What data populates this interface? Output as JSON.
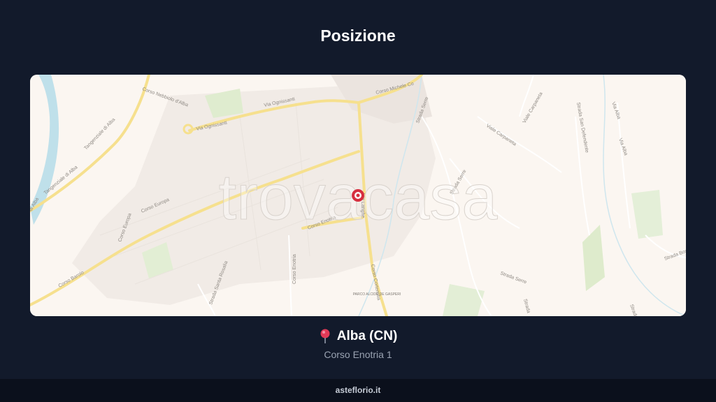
{
  "header": {
    "title": "Posizione"
  },
  "map": {
    "watermark": "trovacasa",
    "streets": {
      "corso_nebbiolo": "Corso Nebbiolo d'Alba",
      "via_ognissanti_1": "Via Ognissanti",
      "via_ognissanti_2": "Via Ognissanti",
      "corso_michele": "Corso Michele Co",
      "tangenziale_1": "Tangenziale di Alba",
      "tangenziale_2": "Tangenziale di Alba",
      "di_alba": "di Alba",
      "corso_europa_1": "Corso Europa",
      "corso_europa_2": "Corso Europa",
      "corso_enotria_1": "Corso Enotria",
      "corso_enotria_2": "Corso Enotria",
      "via_langhe": "Via Langhe",
      "corso_cortemilia": "Corso Cortemilia",
      "corso_barolo": "Corso Barolo",
      "strada_santa_rosalia": "Strada Santa Rosalia",
      "parco": "PARCO ALCIDE DE GASPERI",
      "strada_serre_1": "Strada Serre",
      "strada_serre_2": "Strada Serre",
      "strada_serre_3": "Strada Serre",
      "strada_serre_4": "Strada",
      "viale_carpaneta_1": "Viale Carpaneta",
      "viale_carpaneta_2": "Viale Carpaneta",
      "strada_san_defendente": "Strada San Defendente",
      "via_alba_1": "Via Alba",
      "via_alba_2": "Via Alba",
      "strada_bossola": "Strada Bossola",
      "strada_cu": "Strada Cu"
    }
  },
  "location": {
    "pin_icon": "round-pushpin-icon",
    "city": "Alba (CN)",
    "address": "Corso Enotria 1"
  },
  "footer": {
    "site": "asteflorio.it"
  },
  "colors": {
    "background": "#121a2b",
    "footer_bg": "#0b101c",
    "map_bg": "#fbf6f1",
    "main_road": "#f6e08e",
    "pin": "#d62e3f"
  }
}
